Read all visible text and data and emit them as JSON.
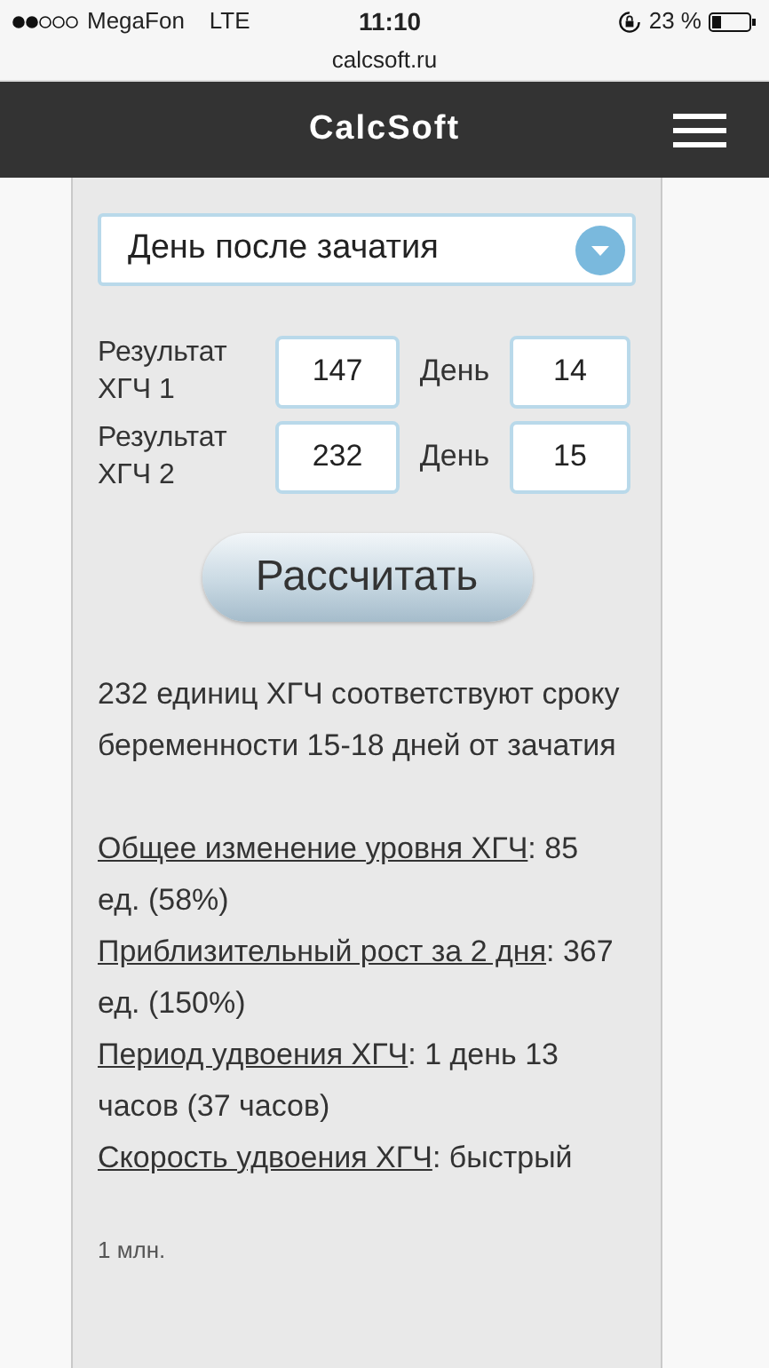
{
  "status_bar": {
    "carrier": "MegaFon",
    "network": "LTE",
    "time": "11:10",
    "battery": "23 %",
    "url": "calcsoft.ru"
  },
  "header": {
    "title": "CalcSoft"
  },
  "form": {
    "mode_select": {
      "value": "День после зачатия"
    },
    "rows": [
      {
        "label": "Результат ХГЧ 1",
        "value": "147",
        "day_label": "День",
        "day": "14"
      },
      {
        "label": "Результат ХГЧ 2",
        "value": "232",
        "day_label": "День",
        "day": "15"
      }
    ],
    "button": "Рассчитать"
  },
  "result": {
    "lines": [
      "232 единиц ХГЧ соответствуют сроку",
      "беременности 15-18 дней от зачатия"
    ],
    "stats": [
      {
        "term": "Общее изменение уровня ХГЧ",
        "value": ": 85 ед. (58%)"
      },
      {
        "term": "Приблизительный рост за 2 дня",
        "value": ": 367 ед. (150%)"
      },
      {
        "term": "Период удвоения ХГЧ",
        "value": ": 1 день 13 часов (37 часов)"
      },
      {
        "term": "Скорость удвоения ХГЧ",
        "value": ": быстрый"
      }
    ]
  },
  "chart": {
    "axis_label": "1 млн."
  }
}
